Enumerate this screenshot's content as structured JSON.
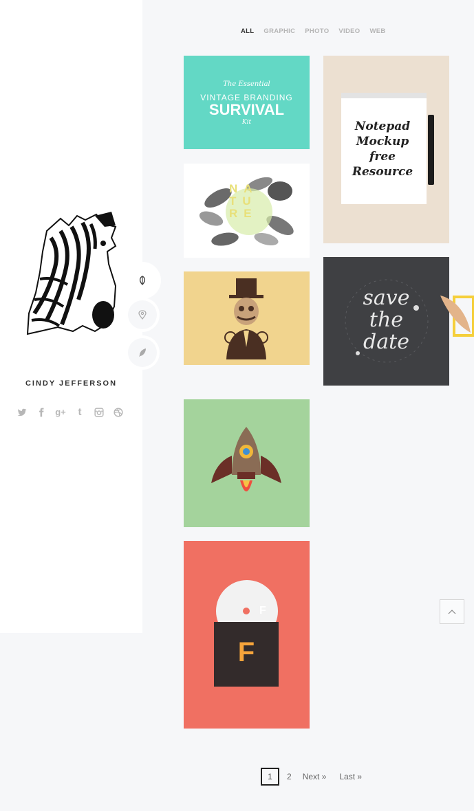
{
  "profile": {
    "name": "CINDY JEFFERSON"
  },
  "social": [
    "twitter-icon",
    "facebook-icon",
    "google-plus-icon",
    "tumblr-icon",
    "instagram-icon",
    "dribbble-icon"
  ],
  "side_nav": [
    "leaf-icon",
    "location-pin-icon",
    "feather-icon"
  ],
  "filters": {
    "all": "ALL",
    "graphic": "GRAPHIC",
    "photo": "PHOTO",
    "video": "VIDEO",
    "web": "WEB",
    "active": "ALL"
  },
  "portfolio": {
    "vintage": {
      "line1": "The Essential",
      "line2": "VINTAGE BRANDING",
      "line3": "SURVIVAL",
      "line4": "Kit",
      "bg": "#63d8c5"
    },
    "nature": {
      "letters": [
        "N",
        "A",
        "T",
        "U",
        "R",
        "E"
      ],
      "bg": "#ffffff"
    },
    "notepad": {
      "line1": "Notepad",
      "line2": "Mockup",
      "line3": "free",
      "line4": "Resource",
      "bg": "#ece0d1"
    },
    "gentleman": {
      "bg": "#f1d48e"
    },
    "save_date": {
      "line1": "save",
      "line2": "the",
      "line3": "date",
      "bg": "#3f4043"
    },
    "rocket": {
      "bg": "#a4d39c"
    },
    "vinyl": {
      "disc_letter": "F",
      "cover_letter": "F",
      "bg": "#f07062"
    }
  },
  "pagination": {
    "current": "1",
    "page2": "2",
    "next": "Next »",
    "last": "Last »"
  },
  "colors": {
    "background": "#f6f7f9",
    "sidebar": "#ffffff",
    "accent_yellow": "#f5cf3b"
  }
}
